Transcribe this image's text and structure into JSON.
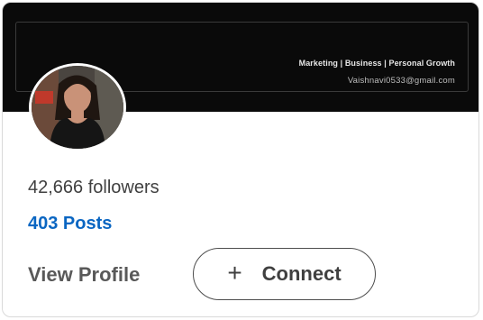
{
  "banner": {
    "tagline": "Marketing | Business | Personal Growth",
    "email": "Vaishnavi0533@gmail.com"
  },
  "profile": {
    "followers_text": "42,666 followers",
    "posts_text": "403 Posts"
  },
  "actions": {
    "view_profile_label": "View Profile",
    "connect_label": "Connect",
    "connect_icon": "plus-icon"
  },
  "colors": {
    "link_blue": "#0a66c2",
    "banner_bg": "#0a0a0a"
  }
}
